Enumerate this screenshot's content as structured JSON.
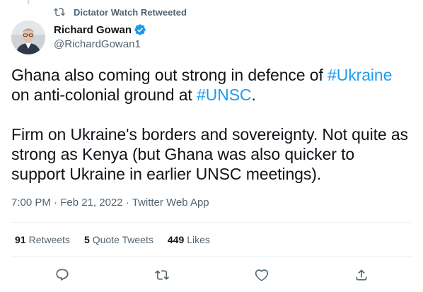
{
  "retweet_context": {
    "text": "Dictator Watch Retweeted",
    "icon": "retweet-icon"
  },
  "author": {
    "display_name": "Richard Gowan",
    "handle": "@RichardGowan1",
    "verified": true,
    "verified_color": "#1d9bf0"
  },
  "tweet": {
    "p1_a": "Ghana also coming out strong in defence of ",
    "p1_tag1": "#Ukraine",
    "p1_b": "on anti-colonial ground at ",
    "p1_tag2": "#UNSC",
    "p1_c": ".",
    "p2": "Firm on Ukraine's borders and sovereignty. Not quite as strong as Kenya (but Ghana was also quicker to support Ukraine in earlier UNSC meetings)."
  },
  "meta": {
    "time": "7:00 PM",
    "sep1": " · ",
    "date": "Feb 21, 2022",
    "sep2": " · ",
    "source": "Twitter Web App"
  },
  "stats": {
    "retweets_count": "91",
    "retweets_label": "Retweets",
    "quotes_count": "5",
    "quotes_label": "Quote Tweets",
    "likes_count": "449",
    "likes_label": "Likes"
  },
  "actions": [
    "reply-icon",
    "retweet-icon",
    "like-icon",
    "share-icon"
  ],
  "colors": {
    "text": "#0f1419",
    "secondary": "#536471",
    "link": "#1d9bf0",
    "divider": "#eff3f4"
  }
}
